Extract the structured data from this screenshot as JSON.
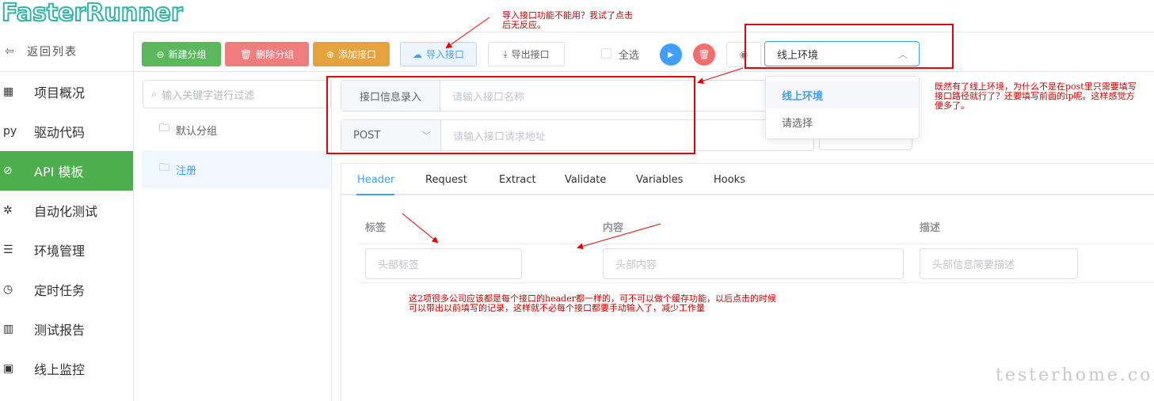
{
  "app": {
    "logo_text": "FasterRunner"
  },
  "sidebar": {
    "back_label": "返回列表",
    "items": [
      {
        "icon": "grid-icon",
        "glyph": "▦",
        "label": "项目概况",
        "active": false
      },
      {
        "icon": "python-icon",
        "glyph": "py",
        "label": "驱动代码",
        "active": false
      },
      {
        "icon": "link-icon",
        "glyph": "⊘",
        "label": "API 模板",
        "active": true
      },
      {
        "icon": "bug-icon",
        "glyph": "✲",
        "label": "自动化测试",
        "active": false
      },
      {
        "icon": "sliders-icon",
        "glyph": "☰",
        "label": "环境管理",
        "active": false
      },
      {
        "icon": "clock-icon",
        "glyph": "◷",
        "label": "定时任务",
        "active": false
      },
      {
        "icon": "chart-icon",
        "glyph": "▥",
        "label": "测试报告",
        "active": false
      },
      {
        "icon": "monitor-icon",
        "glyph": "▣",
        "label": "线上监控",
        "active": false
      }
    ]
  },
  "toolbar": {
    "new_group": "新建分组",
    "delete_group": "删除分组",
    "add_api": "添加接口",
    "import_api": "导入接口",
    "export_api": "导出接口",
    "select_all": "全选",
    "env_value": "线上环境"
  },
  "tree": {
    "filter_placeholder": "输入关键字进行过滤",
    "nodes": [
      "默认分组",
      "注册"
    ]
  },
  "form": {
    "info_label": "接口信息录入",
    "name_placeholder": "请输入接口名称",
    "method": "POST",
    "url_placeholder": "请输入接口请求地址"
  },
  "dropdown": {
    "options": [
      "线上环境",
      "请选择"
    ]
  },
  "tabs": [
    "Header",
    "Request",
    "Extract",
    "Validate",
    "Variables",
    "Hooks"
  ],
  "header_table": {
    "columns": [
      "标签",
      "内容",
      "描述"
    ],
    "placeholders": [
      "头部标签",
      "头部内容",
      "头部信息简要描述"
    ]
  },
  "annotations": {
    "import_note": "导入接口功能不能用？我试了点击\n后无反应。",
    "env_note": "既然有了线上环境，为什么不是在post里只需要填写\n接口路径就行了？还要填写前面的ip呢。这样感觉方\n便多了。",
    "header_note": "这2项很多公司应该都是每个接口的header都一样的，可不可以做个缓存功能，以后点击的时候\n可以带出以前填写的记录，这样就不必每个接口都要手动输入了，减少工作量"
  },
  "watermark": "testerhome.com",
  "colors": {
    "success": "#5cb85c",
    "danger": "#f07c7c",
    "warning": "#e6a23c",
    "primary": "#409eff",
    "active_menu": "#4cae4c",
    "annotation": "#e00000"
  }
}
